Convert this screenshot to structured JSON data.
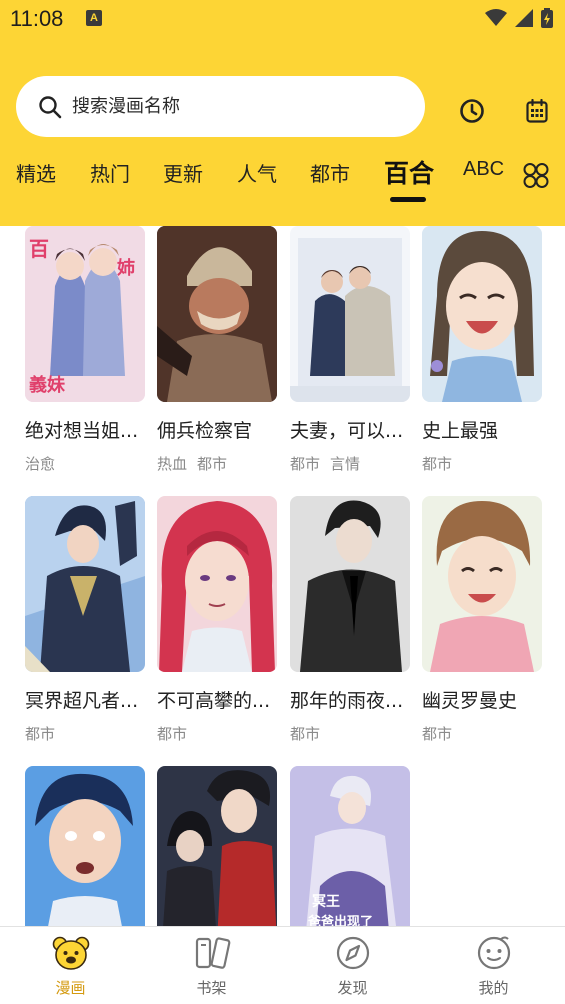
{
  "status": {
    "time": "11:08",
    "notification_badge": "A"
  },
  "search": {
    "placeholder": "搜索漫画名称"
  },
  "tabs": [
    {
      "label": "精选",
      "active": false
    },
    {
      "label": "热门",
      "active": false
    },
    {
      "label": "更新",
      "active": false
    },
    {
      "label": "人气",
      "active": false
    },
    {
      "label": "都市",
      "active": false
    },
    {
      "label": "百合",
      "active": true
    },
    {
      "label": "ABC",
      "active": false
    }
  ],
  "comics": [
    {
      "title": "绝对想当姐...",
      "tags": [
        "治愈"
      ],
      "cover_color": "#e8c6d4"
    },
    {
      "title": "佣兵检察官",
      "tags": [
        "热血",
        "都市"
      ],
      "cover_color": "#6b4a3b"
    },
    {
      "title": "夫妻，可以...",
      "tags": [
        "都市",
        "言情"
      ],
      "cover_color": "#cfd6e6"
    },
    {
      "title": "史上最强",
      "tags": [
        "都市"
      ],
      "cover_color": "#c9dbe8"
    },
    {
      "title": "冥界超凡者...",
      "tags": [
        "都市"
      ],
      "cover_color": "#4a6fa8"
    },
    {
      "title": "不可高攀的...",
      "tags": [
        "都市"
      ],
      "cover_color": "#d43b55"
    },
    {
      "title": "那年的雨夜...",
      "tags": [
        "都市"
      ],
      "cover_color": "#3c3c3c"
    },
    {
      "title": "幽灵罗曼史",
      "tags": [
        "都市"
      ],
      "cover_color": "#f1c1c8"
    },
    {
      "title": "",
      "tags": [],
      "cover_color": "#4d8fd8"
    },
    {
      "title": "",
      "tags": [],
      "cover_color": "#3d4456"
    },
    {
      "title": "",
      "tags": [],
      "cover_color": "#b6b3df"
    }
  ],
  "nav": [
    {
      "label": "漫画",
      "icon": "bear-icon",
      "active": true
    },
    {
      "label": "书架",
      "icon": "bookshelf-icon",
      "active": false
    },
    {
      "label": "发现",
      "icon": "compass-icon",
      "active": false
    },
    {
      "label": "我的",
      "icon": "profile-face-icon",
      "active": false
    }
  ],
  "colors": {
    "accent": "#fdd535",
    "active_nav": "#d49a10"
  }
}
